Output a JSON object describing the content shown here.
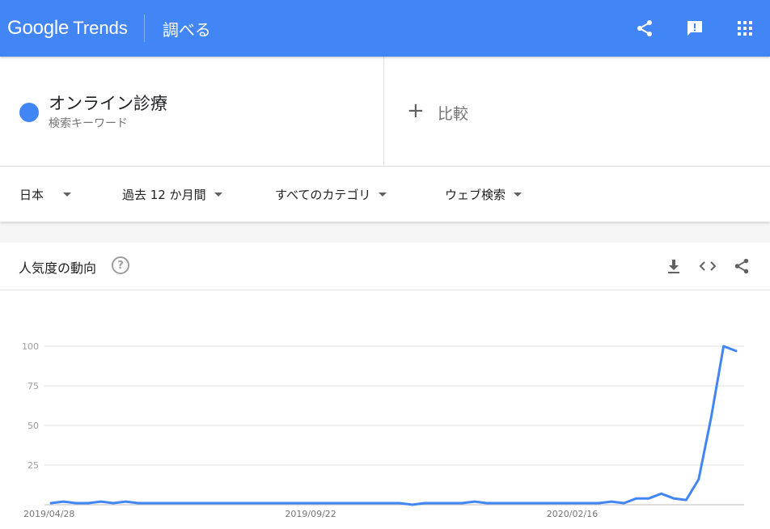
{
  "appbar": {
    "logo_google": "Google",
    "logo_trends": "Trends",
    "title": "調べる",
    "actions": [
      "share-icon",
      "feedback-icon",
      "apps-icon"
    ],
    "color": "#4285f4"
  },
  "terms": [
    {
      "name": "オンライン診療",
      "type": "検索キーワード",
      "color": "#4285f4"
    }
  ],
  "compare": {
    "plus": "+",
    "label": "比較"
  },
  "filters": {
    "region": "日本",
    "period": "過去 12 か月間",
    "category": "すべてのカテゴリ",
    "property": "ウェブ検索"
  },
  "widget": {
    "title": "人気度の動向",
    "help": "?",
    "actions": [
      "download-icon",
      "embed-icon",
      "share-icon"
    ]
  },
  "chart_data": {
    "type": "line",
    "title": "",
    "xlabel": "",
    "ylabel": "",
    "ylim": [
      0,
      100
    ],
    "yticks": [
      25,
      50,
      75,
      100
    ],
    "xticks": [
      "2019/04/28",
      "2019/09/22",
      "2020/02/16"
    ],
    "grid": true,
    "line_color": "#4285f4",
    "series": [
      {
        "values": [
          1,
          2,
          1,
          1,
          2,
          1,
          2,
          1,
          1,
          1,
          1,
          1,
          1,
          1,
          1,
          1,
          1,
          1,
          1,
          1,
          1,
          1,
          1,
          1,
          1,
          1,
          1,
          1,
          1,
          0,
          1,
          1,
          1,
          1,
          2,
          1,
          1,
          1,
          1,
          1,
          1,
          1,
          1,
          1,
          1,
          2,
          1,
          4,
          4,
          7,
          4,
          3,
          16,
          55,
          100,
          97
        ]
      }
    ]
  }
}
